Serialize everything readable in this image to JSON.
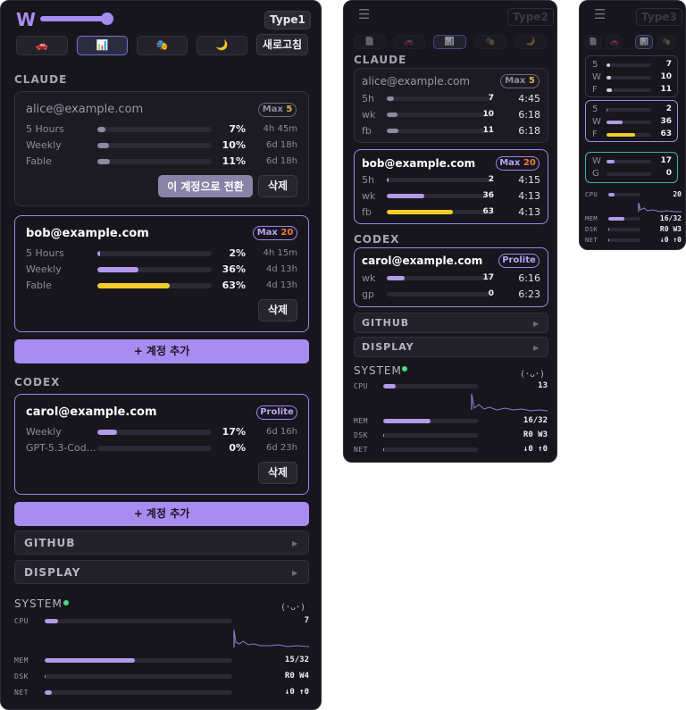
{
  "panel1": {
    "type_label": "Type1",
    "toolbar": {
      "icons": [
        "car-icon",
        "chart-icon",
        "theater-icon",
        "moon-icon"
      ],
      "glyphs": [
        "🚗",
        "📊",
        "🎭",
        "🌙"
      ],
      "refresh_label": "새로고침"
    },
    "slider_level": 0.95,
    "claude": {
      "title": "CLAUDE",
      "accounts": [
        {
          "email": "alice@example.com",
          "plan": "Max",
          "plan_num": "5",
          "rows": [
            {
              "label": "5 Hours",
              "pct": "7%",
              "reset": "4h 45m",
              "value": 7
            },
            {
              "label": "Weekly",
              "pct": "10%",
              "reset": "6d 18h",
              "value": 10
            },
            {
              "label": "Fable",
              "pct": "11%",
              "reset": "6d 18h",
              "value": 11
            }
          ],
          "switch_label": "이 계정으로 전환",
          "delete_label": "삭제"
        },
        {
          "email": "bob@example.com",
          "plan": "Max",
          "plan_num": "20",
          "rows": [
            {
              "label": "5 Hours",
              "pct": "2%",
              "reset": "4h 15m",
              "value": 2
            },
            {
              "label": "Weekly",
              "pct": "36%",
              "reset": "4d 13h",
              "value": 36
            },
            {
              "label": "Fable",
              "pct": "63%",
              "reset": "4d 13h",
              "value": 63
            }
          ],
          "delete_label": "삭제"
        }
      ],
      "add_label": "+ 계정 추가"
    },
    "codex": {
      "title": "CODEX",
      "account": {
        "email": "carol@example.com",
        "plan": "Prolite",
        "rows": [
          {
            "label": "Weekly",
            "pct": "17%",
            "reset": "6d 16h",
            "value": 17
          },
          {
            "label": "GPT-5.3-Cod…",
            "pct": "0%",
            "reset": "6d 23h",
            "value": 0
          }
        ],
        "delete_label": "삭제"
      },
      "add_label": "+ 계정 추가"
    },
    "github_label": "GITHUB",
    "display_label": "DISPLAY",
    "system": {
      "title": "SYSTEM",
      "face": "(･ᴗ･)",
      "rows": [
        {
          "label": "CPU",
          "val": "7",
          "value": 7
        },
        {
          "label": "MEM",
          "val": "15/32",
          "value": 47
        },
        {
          "label": "DSK",
          "val": "R0 W4",
          "value": 0
        },
        {
          "label": "NET",
          "val": "↓0 ↑0",
          "value": 4
        }
      ]
    }
  },
  "panel2": {
    "type_label": "Type2",
    "claude": {
      "title": "CLAUDE",
      "accounts": [
        {
          "email": "alice@example.com",
          "plan": "Max",
          "plan_num": "5",
          "rows": [
            {
              "label": "5h",
              "num": "7",
              "time": "4:45",
              "value": 7
            },
            {
              "label": "wk",
              "num": "10",
              "time": "6:18",
              "value": 10
            },
            {
              "label": "fb",
              "num": "11",
              "time": "6:18",
              "value": 11
            }
          ]
        },
        {
          "email": "bob@example.com",
          "plan": "Max",
          "plan_num": "20",
          "rows": [
            {
              "label": "5h",
              "num": "2",
              "time": "4:15",
              "value": 2
            },
            {
              "label": "wk",
              "num": "36",
              "time": "4:13",
              "value": 36
            },
            {
              "label": "fb",
              "num": "63",
              "time": "4:13",
              "value": 63
            }
          ]
        }
      ]
    },
    "codex": {
      "title": "CODEX",
      "account": {
        "email": "carol@example.com",
        "plan": "Prolite",
        "rows": [
          {
            "label": "wk",
            "num": "17",
            "time": "6:16",
            "value": 17
          },
          {
            "label": "gp",
            "num": "0",
            "time": "6:23",
            "value": 0
          }
        ]
      }
    },
    "github_label": "GITHUB",
    "display_label": "DISPLAY",
    "system": {
      "title": "SYSTEM",
      "face": "(･ᴗ･)",
      "rows": [
        {
          "label": "CPU",
          "val": "13",
          "value": 13
        },
        {
          "label": "MEM",
          "val": "16/32",
          "value": 50
        },
        {
          "label": "DSK",
          "val": "R0 W3",
          "value": 0
        },
        {
          "label": "NET",
          "val": "↓0 ↑0",
          "value": 0
        }
      ]
    }
  },
  "panel3": {
    "type_label": "Type3",
    "cards": [
      {
        "rows": [
          {
            "label": "5",
            "num": "7",
            "value": 7
          },
          {
            "label": "W",
            "num": "10",
            "value": 10
          },
          {
            "label": "F",
            "num": "11",
            "value": 11
          }
        ]
      },
      {
        "rows": [
          {
            "label": "5",
            "num": "2",
            "value": 2
          },
          {
            "label": "W",
            "num": "36",
            "value": 36
          },
          {
            "label": "F",
            "num": "63",
            "value": 63
          }
        ]
      },
      {
        "rows": [
          {
            "label": "W",
            "num": "17",
            "value": 17
          },
          {
            "label": "G",
            "num": "0",
            "value": 0
          }
        ]
      }
    ],
    "system": {
      "rows": [
        {
          "label": "CPU",
          "val": "20",
          "value": 20
        },
        {
          "label": "MEM",
          "val": "16/32",
          "value": 50
        },
        {
          "label": "DSK",
          "val": "R0 W3",
          "value": 0
        },
        {
          "label": "NET",
          "val": "↓0 ↑0",
          "value": 0
        }
      ]
    }
  },
  "colors": {
    "accent": "#a98cf0",
    "yellow": "#f2cd2a",
    "teal": "#38b6a8",
    "green": "#4ade80",
    "panel_bg": "#17161d"
  }
}
